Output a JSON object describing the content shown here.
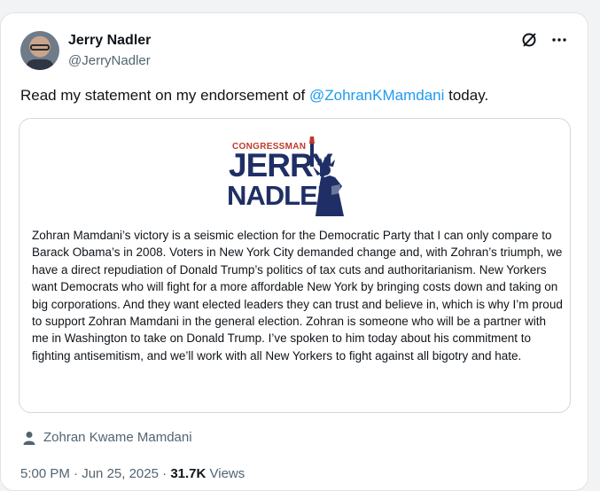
{
  "author": {
    "name": "Jerry Nadler",
    "handle": "@JerryNadler"
  },
  "icons": {
    "grok": "grok-icon",
    "more": "more-icon",
    "person": "person-icon"
  },
  "tweet": {
    "text_before": "Read my statement on my endorsement of ",
    "mention": "@ZohranKMamdani",
    "text_after": " today."
  },
  "quote": {
    "logo": {
      "congressman": "CONGRESSMAN",
      "jerry": "JERRY",
      "nadler": "NADLER"
    },
    "statement": "Zohran Mamdani’s victory is a seismic election for the Democratic Party that I can only compare to Barack Obama’s in 2008. Voters in New York City demanded change and, with Zohran’s triumph, we have a direct repudiation of Donald Trump’s politics of tax cuts and authoritarianism. New Yorkers want Democrats who will fight for a more affordable New York by bringing costs down and taking on big corporations. And they want elected leaders they can trust and believe in, which is why I’m proud to support Zohran Mamdani in the general election. Zohran is someone who will be a partner with me in Washington to take on Donald Trump. I’ve spoken to him today about his commitment to fighting antisemitism, and we’ll work with all New Yorkers to fight against all bigotry and hate."
  },
  "tagged_person": "Zohran Kwame Mamdani",
  "meta": {
    "time": "5:00 PM",
    "separator": " · ",
    "date": "Jun 25, 2025",
    "views_count": "31.7K",
    "views_label": " Views"
  },
  "colors": {
    "link": "#1d9bf0",
    "logo_red": "#c0392b",
    "logo_navy": "#1f2f66"
  }
}
